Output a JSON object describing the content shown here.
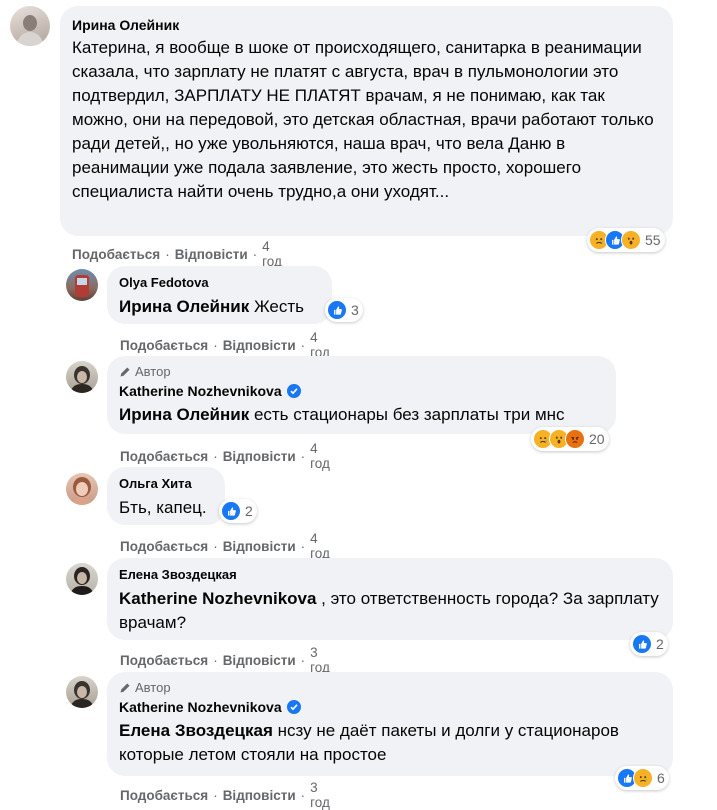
{
  "actions": {
    "like": "Подобається",
    "reply": "Відповісти",
    "dot": "·"
  },
  "comments": [
    {
      "author": "Ирина Олейник",
      "text": "Катерина, я вообще в шоке от происходящего, санитарка в реанимации сказала, что зарплату не платят с августа, врач в пульмонологии это подтвердил, ЗАРПЛАТУ НЕ ПЛАТЯТ врачам, я не понимаю, как так можно, они на передовой, это детская областная, врачи работают только ради детей,, но уже увольняются, наша врач, что вела Даню в реанимации уже подала заявление, это жесть просто, хорошего специалиста найти очень трудно,а они уходят...",
      "time": "4 год",
      "reactions": [
        "sad",
        "like",
        "wow"
      ],
      "reaction_count": "55"
    },
    {
      "author": "Olya Fedotova",
      "mention": "Ирина Олейник",
      "text": " Жесть",
      "time": "4 год",
      "reactions": [
        "like"
      ],
      "reaction_count": "3"
    },
    {
      "author_tag": "Автор",
      "author": "Katherine Nozhevnikova",
      "verified": true,
      "mention": "Ирина Олейник",
      "text": " есть стационары без зарплаты три мнс",
      "time": "4 год",
      "reactions": [
        "sad",
        "wow",
        "angry"
      ],
      "reaction_count": "20"
    },
    {
      "author": "Ольга Хита",
      "text": "Бть, капец.",
      "time": "4 год",
      "reactions": [
        "like"
      ],
      "reaction_count": "2"
    },
    {
      "author": "Елена Звоздецкая",
      "mention": "Katherine Nozhevnikova",
      "text": " , это ответственность города? За зарплату врачам?",
      "time": "3 год",
      "reactions": [
        "like"
      ],
      "reaction_count": "2"
    },
    {
      "author_tag": "Автор",
      "author": "Katherine Nozhevnikova",
      "verified": true,
      "mention": "Елена Звоздецкая",
      "text": " нсзу не даёт пакеты и долги у стационаров которые летом стояли на простое",
      "time": "3 год",
      "reactions": [
        "like",
        "sad"
      ],
      "reaction_count": "6"
    }
  ],
  "colors": {
    "bubble": "#f0f2f5",
    "like": "#1877f2",
    "meta": "#65676b"
  }
}
